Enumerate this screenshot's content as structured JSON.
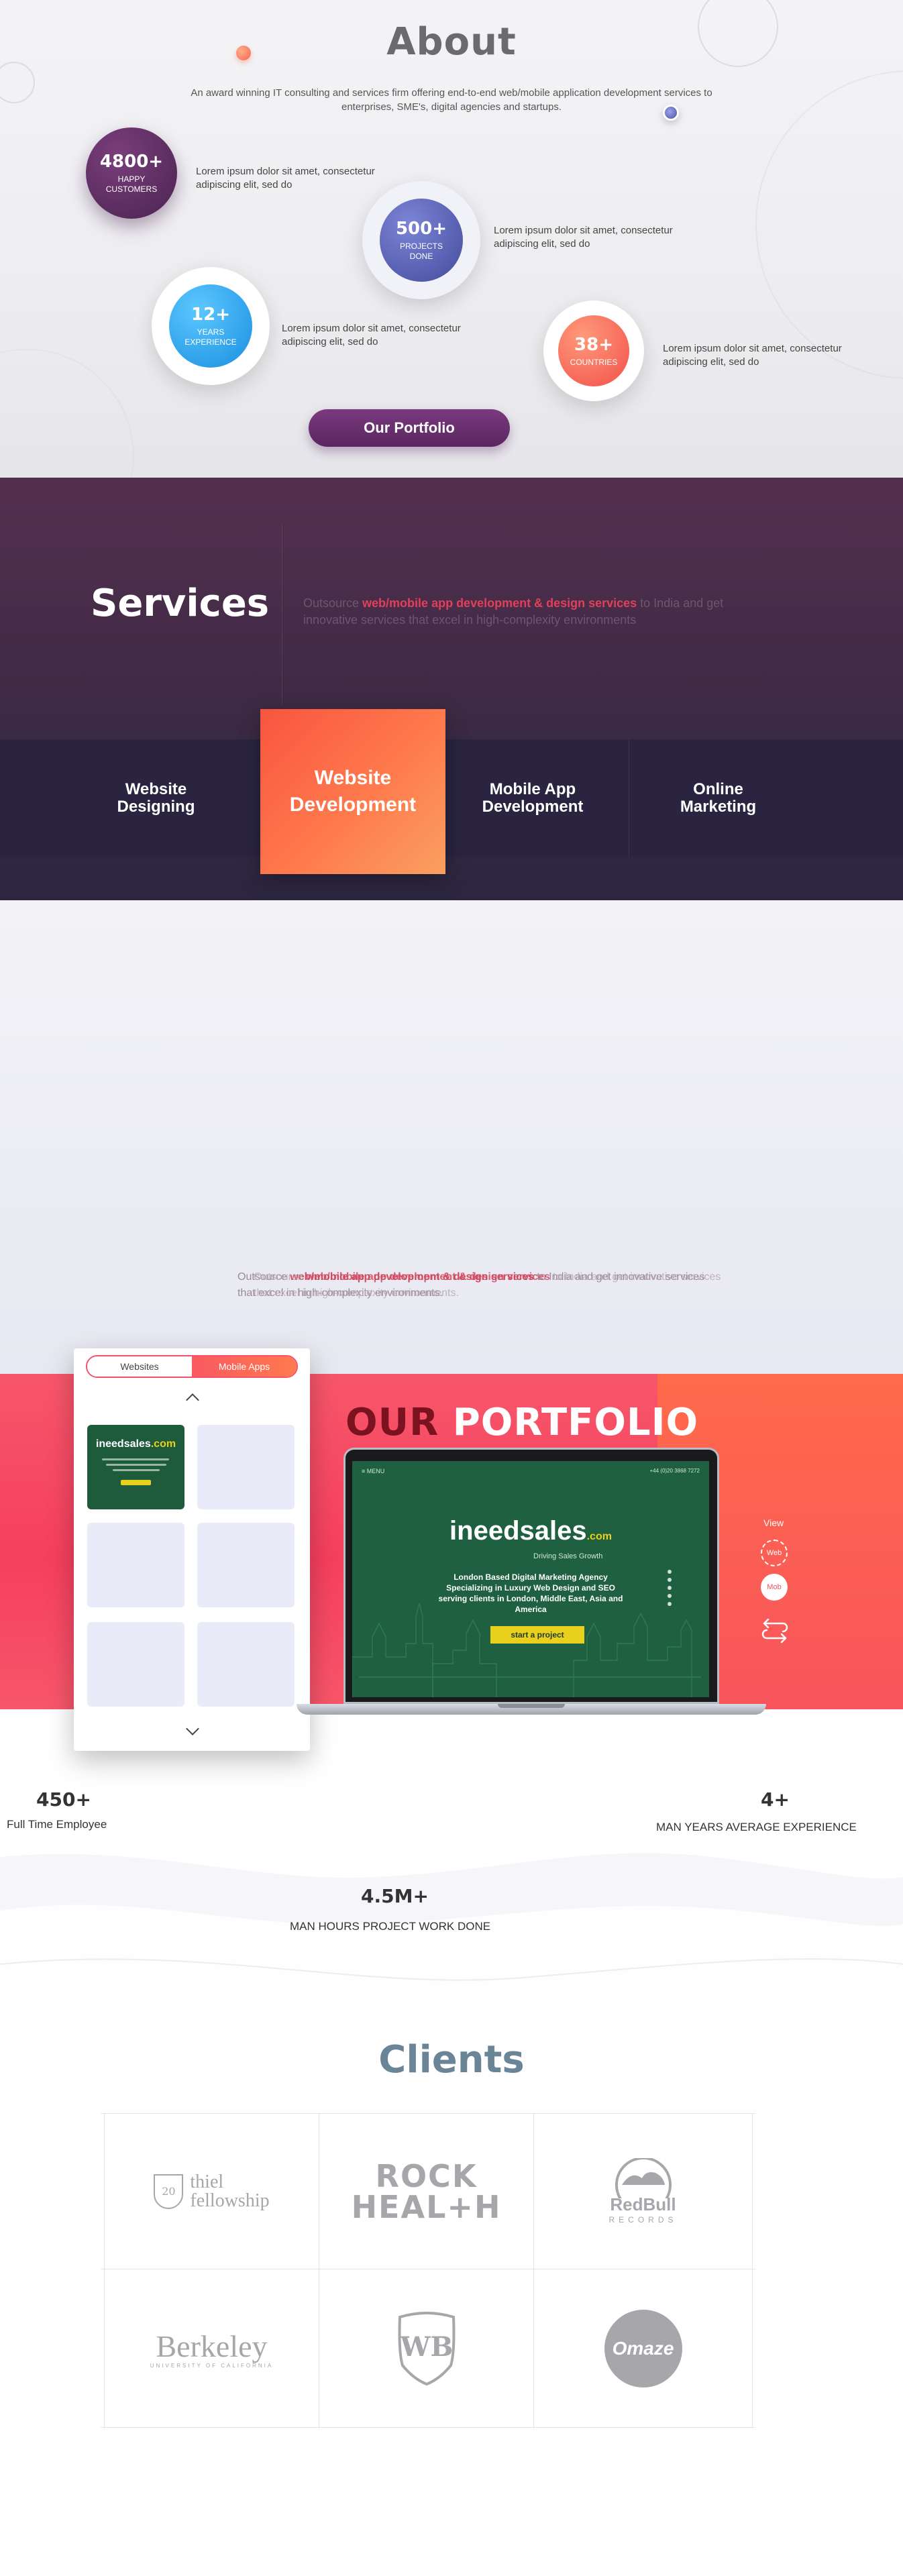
{
  "about": {
    "title": "About",
    "intro": "An award winning IT consulting and services firm offering end-to-end web/mobile application development services to enterprises, SME's, digital agencies and startups.",
    "stats": [
      {
        "number": "4800+",
        "label_line1": "HAPPY",
        "label_line2": "CUSTOMERS",
        "text": "Lorem ipsum dolor sit amet, consectetur adipiscing elit, sed do",
        "color": "#5a2e5c"
      },
      {
        "number": "500+",
        "label_line1": "PROJECTS",
        "label_line2": "DONE",
        "text": "Lorem ipsum dolor sit amet, consectetur adipiscing elit, sed do",
        "color": "#5a64b4"
      },
      {
        "number": "12+",
        "label_line1": "YEARS",
        "label_line2": "EXPERIENCE",
        "text": "Lorem ipsum dolor sit amet, consectetur adipiscing elit, sed do",
        "color": "#2aa8ee"
      },
      {
        "number": "38+",
        "label_line1": "COUNTRIES",
        "label_line2": "",
        "text": "Lorem ipsum dolor sit amet, consectetur adipiscing elit, sed do",
        "color": "#f7624f"
      }
    ],
    "portfolio_button": "Our Portfolio"
  },
  "services": {
    "title": "Services",
    "desc_prefix": "Outsource ",
    "desc_highlight": "web/mobile app development & design services",
    "desc_suffix": " to India and get innovative services that excel in high-complexity environments",
    "tabs": [
      "Website\nDesigning",
      "Website\nDevelopment",
      "Mobile App\nDevelopment",
      "Online\nMarketing"
    ],
    "active_index": 1
  },
  "ghost_text": {
    "prefix": "Outsource ",
    "highlight": "web/mobile app development & design services",
    "suffix": " to India and get innovative services that excel in high-complexity environments."
  },
  "portfolio": {
    "title_part1": "OUR ",
    "title_part2": "PORTFOLIO",
    "tabs": [
      "Websites",
      "Mobile Apps"
    ],
    "active_tab": "Websites",
    "tile_brand": "ineedsales",
    "tile_brand_suffix": ".com",
    "screen": {
      "nav_left": "≡  MENU",
      "nav_right": "+44 (0)20 3868 7272",
      "brand": "ineedsales",
      "brand_suffix": ".com",
      "tagline": "Driving Sales Growth",
      "description": "London Based Digital Marketing Agency Specializing in Luxury Web Design and SEO serving clients in London, Middle East, Asia and America",
      "button": "start a project"
    },
    "view_label": "View",
    "view_options": [
      "Web",
      "Mob"
    ]
  },
  "stats": {
    "employees_number": "450+",
    "employees_label": "Full Time Employee",
    "experience_number": "4+",
    "experience_label": "MAN YEARS AVERAGE EXPERIENCE",
    "hours_number": "4.5M+",
    "hours_label": "MAN HOURS PROJECT WORK DONE"
  },
  "clients": {
    "title": "Clients",
    "logos": [
      {
        "name": "thiel fellowship",
        "line1": "thiel",
        "line2": "fellowship",
        "badge": "20"
      },
      {
        "name": "Rock Health",
        "line1": "ROCK",
        "line2": "HEAL+H"
      },
      {
        "name": "Red Bull Records",
        "line1": "RedBull",
        "line2": "RECORDS"
      },
      {
        "name": "Berkeley",
        "line1": "Berkeley",
        "line2": "UNIVERSITY OF CALIFORNIA"
      },
      {
        "name": "Warner Bros",
        "line1": "WB"
      },
      {
        "name": "Omaze",
        "line1": "Omaze"
      }
    ]
  }
}
